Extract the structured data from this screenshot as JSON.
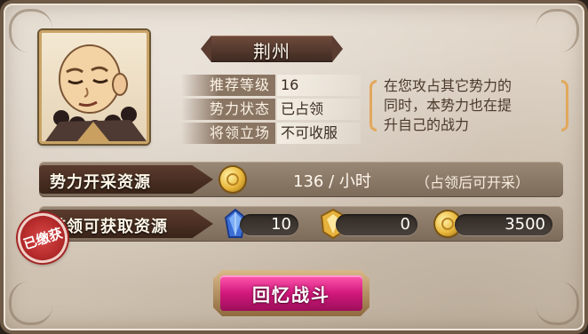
{
  "city": {
    "name": "荆州"
  },
  "info": [
    {
      "label": "推荐等级",
      "value": "16"
    },
    {
      "label": "势力状态",
      "value": "已占领"
    },
    {
      "label": "将领立场",
      "value": "不可收服"
    }
  ],
  "note": {
    "lines": [
      "在您攻占其它势力的",
      "同时，本势力也在提",
      "升自己的战力"
    ]
  },
  "production": {
    "label": "势力开采资源",
    "rate": "136 / 小时",
    "hint": "（占领后可开采）"
  },
  "rewards": {
    "label": "首领可获取资源",
    "crystal": "10",
    "badge": "0",
    "gold": "3500"
  },
  "stamp": {
    "text": "已缴获"
  },
  "battle": {
    "label": "回忆战斗"
  },
  "colors": {
    "accent": "#d2187c",
    "note_bracket": "#e2a85c",
    "stamp": "#b62b2b"
  },
  "icons": {
    "gold": "gold-coin-icon",
    "crystal": "blue-crystal-icon",
    "badge": "gold-badge-icon"
  }
}
